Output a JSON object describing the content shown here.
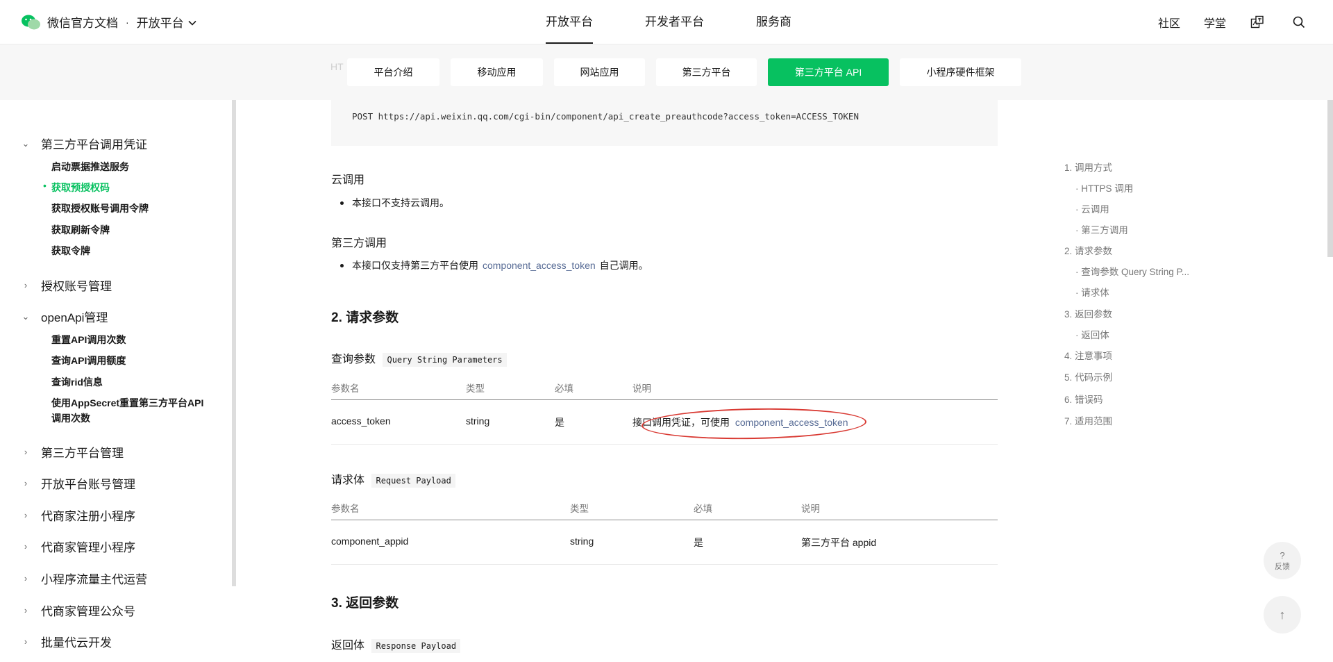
{
  "header": {
    "brand": "微信官方文档",
    "separator": "·",
    "platform": "开放平台",
    "nav": [
      {
        "label": "开放平台",
        "active": true
      },
      {
        "label": "开发者平台",
        "active": false
      },
      {
        "label": "服务商",
        "active": false
      }
    ],
    "right_links": [
      "社区",
      "学堂"
    ],
    "icons": [
      "translate-icon",
      "search-icon"
    ]
  },
  "subnav": {
    "ghost": "HT",
    "tabs": [
      {
        "label": "平台介绍",
        "active": false
      },
      {
        "label": "移动应用",
        "active": false
      },
      {
        "label": "网站应用",
        "active": false
      },
      {
        "label": "第三方平台",
        "active": false
      },
      {
        "label": "第三方平台 API",
        "active": true
      },
      {
        "label": "小程序硬件框架",
        "active": false
      }
    ]
  },
  "sidebar": {
    "groups": [
      {
        "label": "第三方平台调用凭证",
        "expanded": true
      },
      {
        "label": "授权账号管理",
        "expanded": false
      },
      {
        "label": "openApi管理",
        "expanded": true
      },
      {
        "label": "第三方平台管理",
        "expanded": false
      },
      {
        "label": "开放平台账号管理",
        "expanded": false
      },
      {
        "label": "代商家注册小程序",
        "expanded": false
      },
      {
        "label": "代商家管理小程序",
        "expanded": false
      },
      {
        "label": "小程序流量主代运营",
        "expanded": false
      },
      {
        "label": "代商家管理公众号",
        "expanded": false
      },
      {
        "label": "批量代云开发",
        "expanded": false
      }
    ],
    "items_group1": [
      "启动票据推送服务",
      "获取预授权码",
      "获取授权账号调用令牌",
      "获取刷新令牌",
      "获取令牌"
    ],
    "active_item": "获取预授权码",
    "items_group3": [
      "重置API调用次数",
      "查询API调用额度",
      "查询rid信息",
      "使用AppSecret重置第三方平台API",
      "调用次数"
    ]
  },
  "content": {
    "code": "POST https://api.weixin.qq.com/cgi-bin/component/api_create_preauthcode?access_token=ACCESS_TOKEN",
    "cloud_title": "云调用",
    "cloud_text": "本接口不支持云调用。",
    "third_title": "第三方调用",
    "third_text_a": "本接口仅支持第三方平台使用",
    "third_link": "component_access_token",
    "third_text_b": "自己调用。",
    "section2": "2. 请求参数",
    "query_title": "查询参数",
    "query_tag": "Query String Parameters",
    "table1_headers": [
      "参数名",
      "类型",
      "必填",
      "说明"
    ],
    "table1_row": [
      "access_token",
      "string",
      "是",
      "接口调用凭证，可使用",
      "component_access_token"
    ],
    "payload_title": "请求体",
    "payload_tag": "Request Payload",
    "table2_headers": [
      "参数名",
      "类型",
      "必填",
      "说明"
    ],
    "table2_row": [
      "component_appid",
      "string",
      "是",
      "第三方平台 appid"
    ],
    "section3": "3. 返回参数",
    "response_title": "返回体",
    "response_tag": "Response Payload"
  },
  "toc": [
    "1. 调用方式",
    "· HTTPS 调用",
    "· 云调用",
    "· 第三方调用",
    "2. 请求参数",
    "· 查询参数 Query String P...",
    "· 请求体",
    "3. 返回参数",
    "· 返回体",
    "4. 注意事项",
    "5. 代码示例",
    "6. 错误码",
    "7. 适用范围"
  ],
  "float": {
    "feedback_q": "?",
    "feedback_label": "反馈",
    "top_arrow": "↑"
  },
  "colors": {
    "accent": "#07c160",
    "link": "#576b95",
    "annotation": "#d93a33"
  }
}
